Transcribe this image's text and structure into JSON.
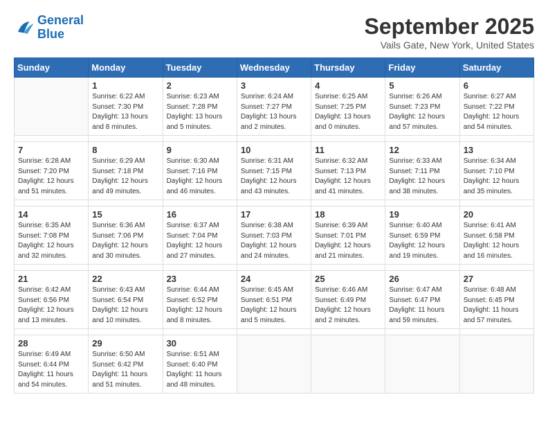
{
  "logo": {
    "line1": "General",
    "line2": "Blue"
  },
  "title": "September 2025",
  "subtitle": "Vails Gate, New York, United States",
  "weekdays": [
    "Sunday",
    "Monday",
    "Tuesday",
    "Wednesday",
    "Thursday",
    "Friday",
    "Saturday"
  ],
  "weeks": [
    [
      {
        "day": "",
        "info": ""
      },
      {
        "day": "1",
        "info": "Sunrise: 6:22 AM\nSunset: 7:30 PM\nDaylight: 13 hours\nand 8 minutes."
      },
      {
        "day": "2",
        "info": "Sunrise: 6:23 AM\nSunset: 7:28 PM\nDaylight: 13 hours\nand 5 minutes."
      },
      {
        "day": "3",
        "info": "Sunrise: 6:24 AM\nSunset: 7:27 PM\nDaylight: 13 hours\nand 2 minutes."
      },
      {
        "day": "4",
        "info": "Sunrise: 6:25 AM\nSunset: 7:25 PM\nDaylight: 13 hours\nand 0 minutes."
      },
      {
        "day": "5",
        "info": "Sunrise: 6:26 AM\nSunset: 7:23 PM\nDaylight: 12 hours\nand 57 minutes."
      },
      {
        "day": "6",
        "info": "Sunrise: 6:27 AM\nSunset: 7:22 PM\nDaylight: 12 hours\nand 54 minutes."
      }
    ],
    [
      {
        "day": "7",
        "info": "Sunrise: 6:28 AM\nSunset: 7:20 PM\nDaylight: 12 hours\nand 51 minutes."
      },
      {
        "day": "8",
        "info": "Sunrise: 6:29 AM\nSunset: 7:18 PM\nDaylight: 12 hours\nand 49 minutes."
      },
      {
        "day": "9",
        "info": "Sunrise: 6:30 AM\nSunset: 7:16 PM\nDaylight: 12 hours\nand 46 minutes."
      },
      {
        "day": "10",
        "info": "Sunrise: 6:31 AM\nSunset: 7:15 PM\nDaylight: 12 hours\nand 43 minutes."
      },
      {
        "day": "11",
        "info": "Sunrise: 6:32 AM\nSunset: 7:13 PM\nDaylight: 12 hours\nand 41 minutes."
      },
      {
        "day": "12",
        "info": "Sunrise: 6:33 AM\nSunset: 7:11 PM\nDaylight: 12 hours\nand 38 minutes."
      },
      {
        "day": "13",
        "info": "Sunrise: 6:34 AM\nSunset: 7:10 PM\nDaylight: 12 hours\nand 35 minutes."
      }
    ],
    [
      {
        "day": "14",
        "info": "Sunrise: 6:35 AM\nSunset: 7:08 PM\nDaylight: 12 hours\nand 32 minutes."
      },
      {
        "day": "15",
        "info": "Sunrise: 6:36 AM\nSunset: 7:06 PM\nDaylight: 12 hours\nand 30 minutes."
      },
      {
        "day": "16",
        "info": "Sunrise: 6:37 AM\nSunset: 7:04 PM\nDaylight: 12 hours\nand 27 minutes."
      },
      {
        "day": "17",
        "info": "Sunrise: 6:38 AM\nSunset: 7:03 PM\nDaylight: 12 hours\nand 24 minutes."
      },
      {
        "day": "18",
        "info": "Sunrise: 6:39 AM\nSunset: 7:01 PM\nDaylight: 12 hours\nand 21 minutes."
      },
      {
        "day": "19",
        "info": "Sunrise: 6:40 AM\nSunset: 6:59 PM\nDaylight: 12 hours\nand 19 minutes."
      },
      {
        "day": "20",
        "info": "Sunrise: 6:41 AM\nSunset: 6:58 PM\nDaylight: 12 hours\nand 16 minutes."
      }
    ],
    [
      {
        "day": "21",
        "info": "Sunrise: 6:42 AM\nSunset: 6:56 PM\nDaylight: 12 hours\nand 13 minutes."
      },
      {
        "day": "22",
        "info": "Sunrise: 6:43 AM\nSunset: 6:54 PM\nDaylight: 12 hours\nand 10 minutes."
      },
      {
        "day": "23",
        "info": "Sunrise: 6:44 AM\nSunset: 6:52 PM\nDaylight: 12 hours\nand 8 minutes."
      },
      {
        "day": "24",
        "info": "Sunrise: 6:45 AM\nSunset: 6:51 PM\nDaylight: 12 hours\nand 5 minutes."
      },
      {
        "day": "25",
        "info": "Sunrise: 6:46 AM\nSunset: 6:49 PM\nDaylight: 12 hours\nand 2 minutes."
      },
      {
        "day": "26",
        "info": "Sunrise: 6:47 AM\nSunset: 6:47 PM\nDaylight: 11 hours\nand 59 minutes."
      },
      {
        "day": "27",
        "info": "Sunrise: 6:48 AM\nSunset: 6:45 PM\nDaylight: 11 hours\nand 57 minutes."
      }
    ],
    [
      {
        "day": "28",
        "info": "Sunrise: 6:49 AM\nSunset: 6:44 PM\nDaylight: 11 hours\nand 54 minutes."
      },
      {
        "day": "29",
        "info": "Sunrise: 6:50 AM\nSunset: 6:42 PM\nDaylight: 11 hours\nand 51 minutes."
      },
      {
        "day": "30",
        "info": "Sunrise: 6:51 AM\nSunset: 6:40 PM\nDaylight: 11 hours\nand 48 minutes."
      },
      {
        "day": "",
        "info": ""
      },
      {
        "day": "",
        "info": ""
      },
      {
        "day": "",
        "info": ""
      },
      {
        "day": "",
        "info": ""
      }
    ]
  ]
}
